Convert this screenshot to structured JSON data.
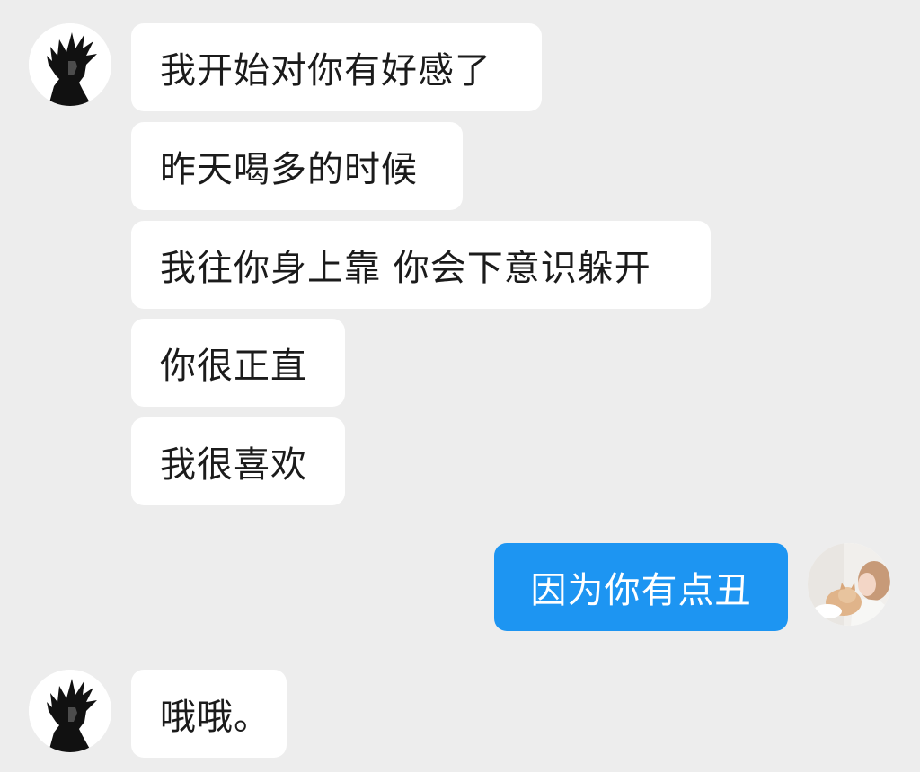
{
  "colors": {
    "background": "#ededed",
    "incoming_bubble": "#ffffff",
    "outgoing_bubble": "#1d95f2",
    "incoming_text": "#1b1b1b",
    "outgoing_text": "#ffffff"
  },
  "contact": {
    "avatar_icon": "dark-hair-portrait-avatar-icon"
  },
  "me": {
    "avatar_icon": "photo-with-cat-avatar-icon"
  },
  "messages": [
    {
      "sender": "contact",
      "text": "我开始对你有好感了"
    },
    {
      "sender": "contact",
      "text": "昨天喝多的时候"
    },
    {
      "sender": "contact",
      "text": "我往你身上靠 你会下意识躲开"
    },
    {
      "sender": "contact",
      "text": "你很正直"
    },
    {
      "sender": "contact",
      "text": "我很喜欢"
    },
    {
      "sender": "me",
      "text": "因为你有点丑"
    },
    {
      "sender": "contact",
      "text": "哦哦。"
    }
  ]
}
